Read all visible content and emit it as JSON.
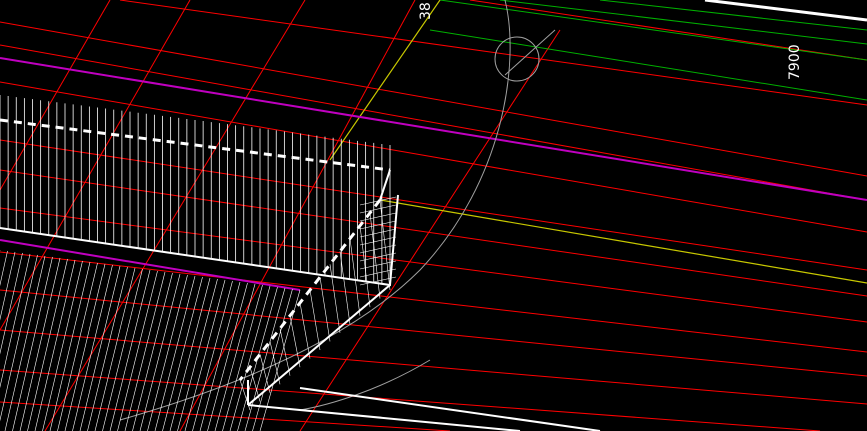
{
  "canvas": {
    "background_color": "#000000",
    "dimension_labels": [
      "38",
      "7900"
    ]
  },
  "colors": {
    "grid_red": "#ff0000",
    "axis_green": "#00b000",
    "axis_yellow": "#c8c800",
    "axis_magenta": "#c000c0",
    "geometry_white": "#ffffff",
    "arc_gray": "#a0a0a0"
  }
}
